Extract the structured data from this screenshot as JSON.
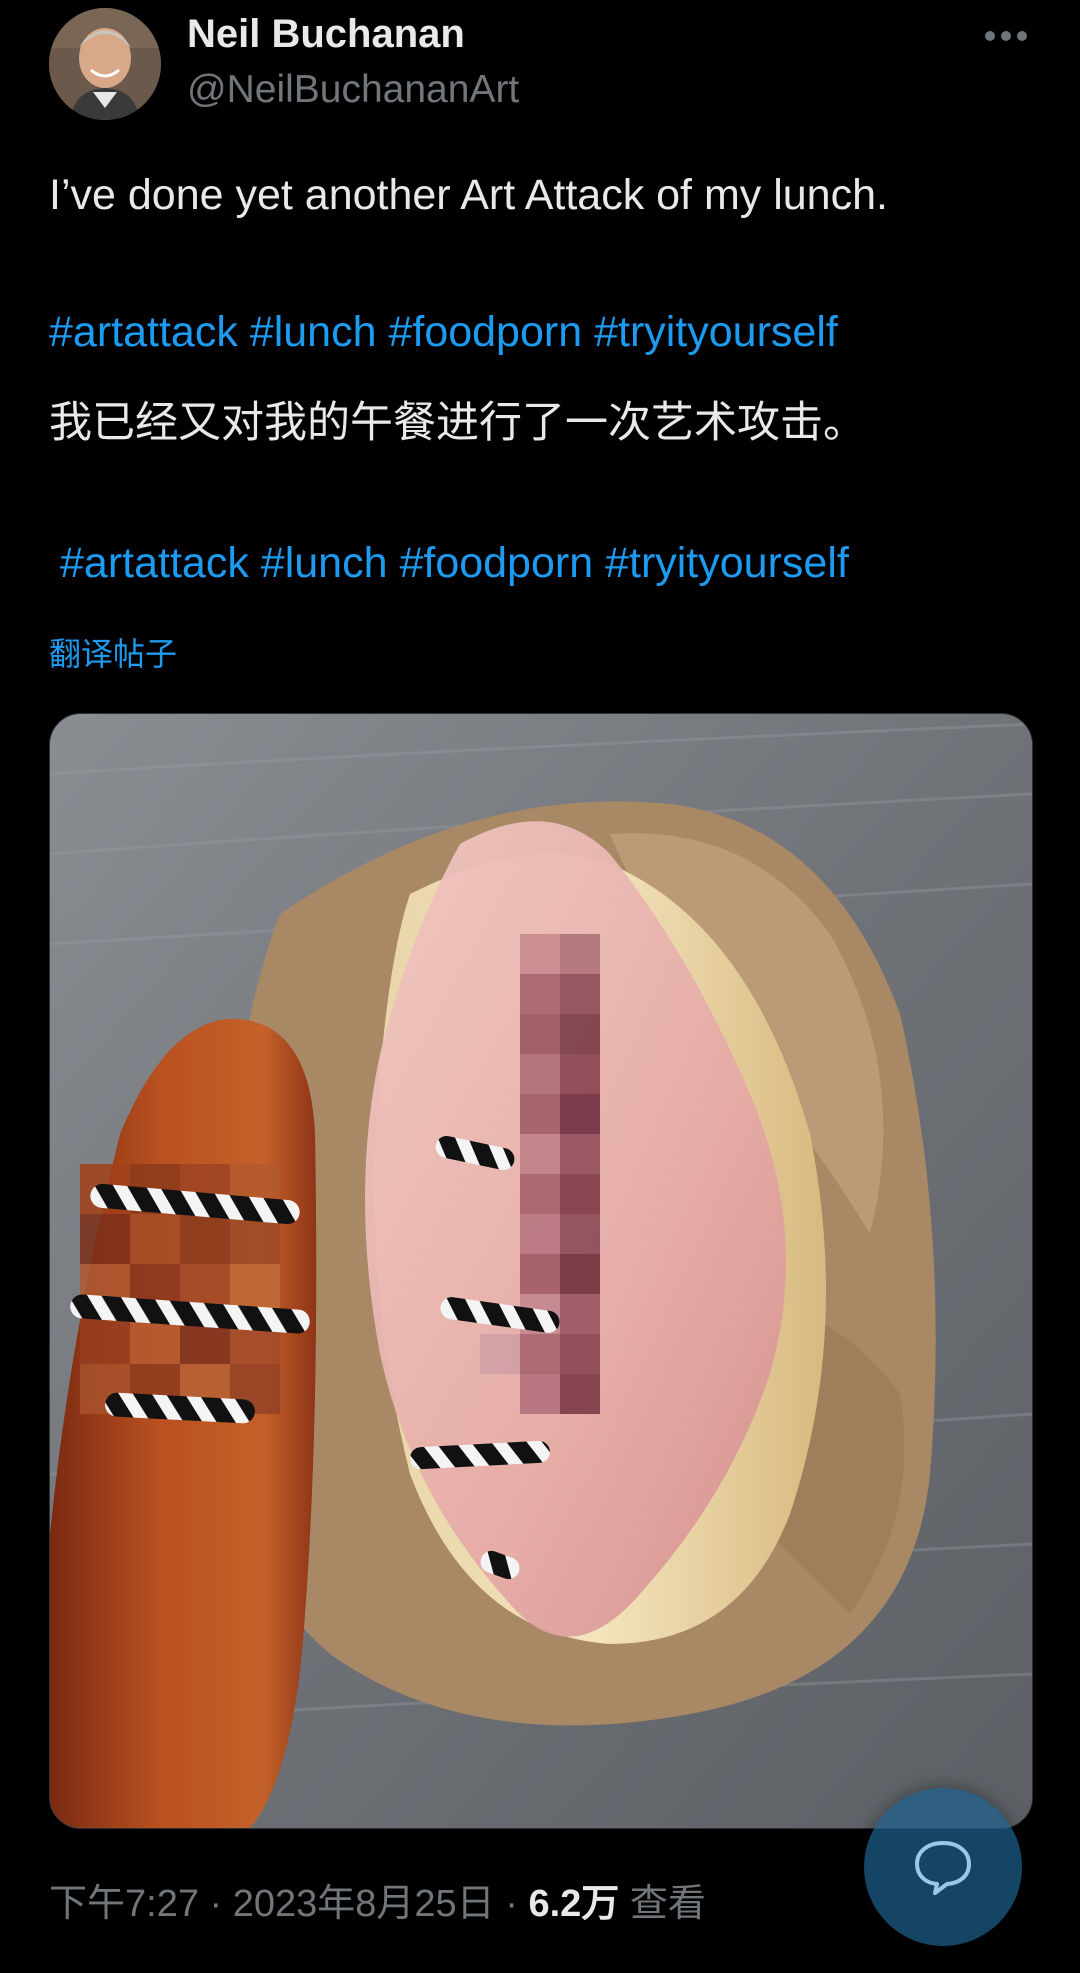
{
  "author": {
    "display_name": "Neil Buchanan",
    "handle": "@NeilBuchananArt"
  },
  "post": {
    "text_en": "I’ve done yet another Art Attack of my lunch.",
    "hashtags_en": [
      "#artattack",
      "#lunch",
      "#foodporn",
      "#tryityourself"
    ],
    "text_zh": "我已经又对我的午餐进行了一次艺术攻击。",
    "hashtags_zh": [
      "#artattack",
      "#lunch",
      "#foodporn",
      "#tryityourself"
    ],
    "translate_label": "翻译帖子"
  },
  "meta": {
    "time": "下午7:27",
    "date": "2023年8月25日",
    "separator": "·",
    "views_count": "6.2万",
    "views_label": "查看"
  },
  "icons": {
    "more": "more-horizontal-icon",
    "reply": "reply-bubble-icon"
  },
  "colors": {
    "background": "#000000",
    "text_primary": "#e7e9ea",
    "text_secondary": "#71767b",
    "link": "#1d9bf0"
  }
}
